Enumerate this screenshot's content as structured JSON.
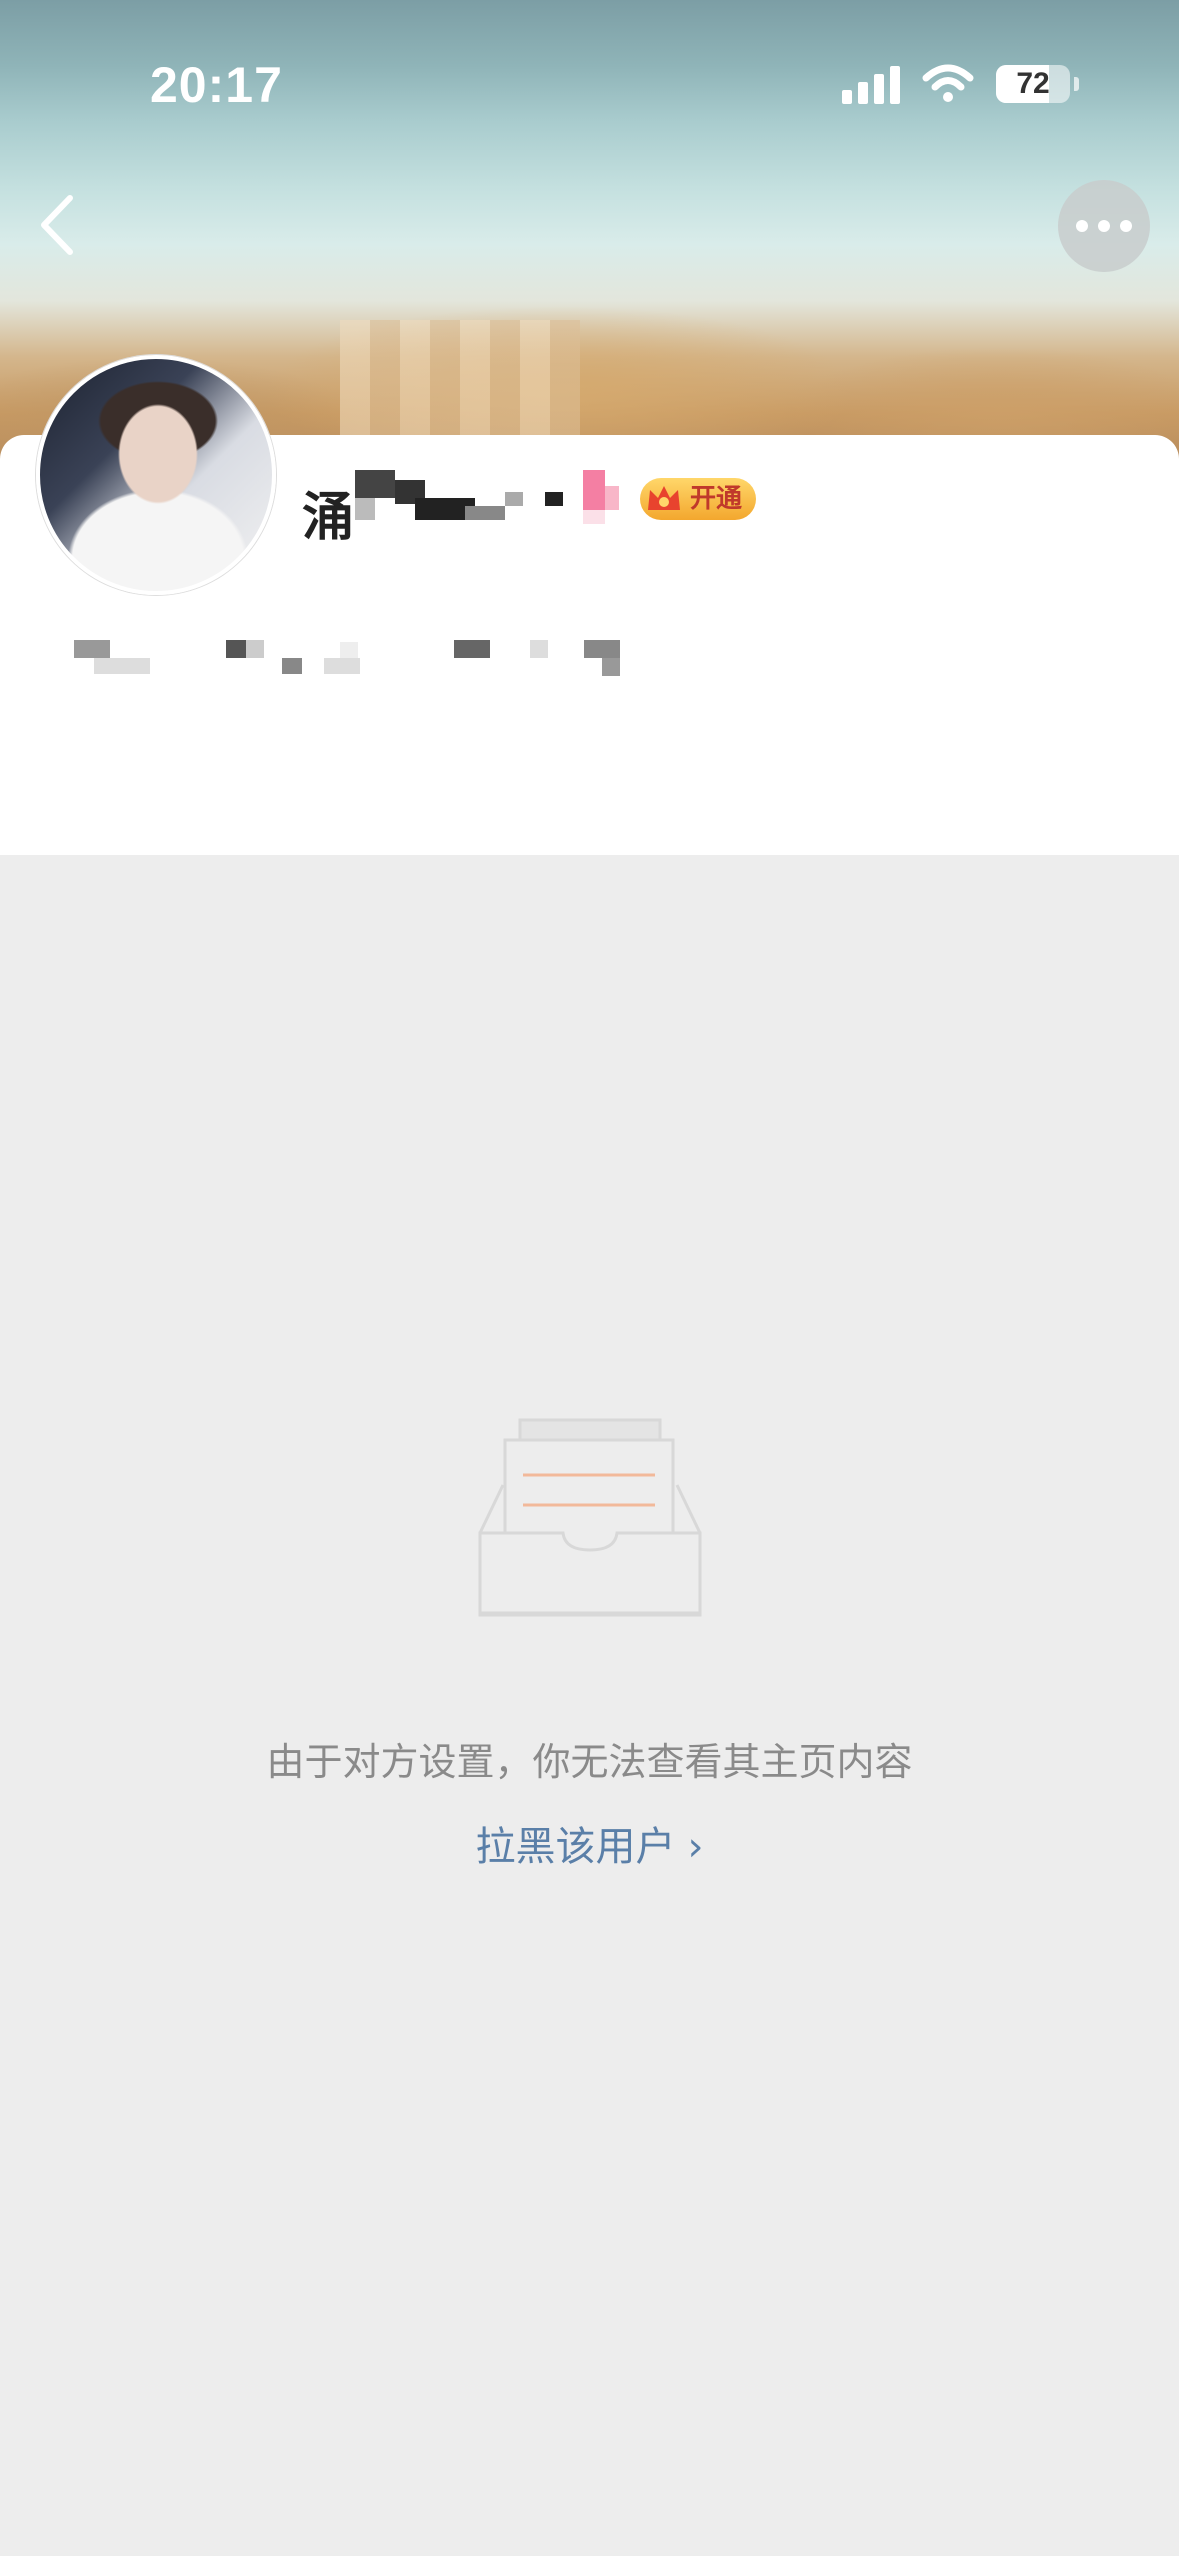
{
  "status_bar": {
    "time": "20:17",
    "battery": "72"
  },
  "profile": {
    "name_visible_char": "涌",
    "vip_badge_label": "开通"
  },
  "empty_state": {
    "message": "由于对方设置，你无法查看其主页内容",
    "action_label": "拉黑该用户",
    "action_chevron": "›"
  },
  "colors": {
    "background": "#ededed",
    "card": "#ffffff",
    "link": "#5a7fa8",
    "muted_text": "#8a8a8a",
    "vip_gold": "#f3a72e"
  },
  "icons": {
    "back": "chevron-left-icon",
    "more": "more-dots-icon",
    "empty": "empty-inbox-icon",
    "crown": "crown-icon"
  }
}
